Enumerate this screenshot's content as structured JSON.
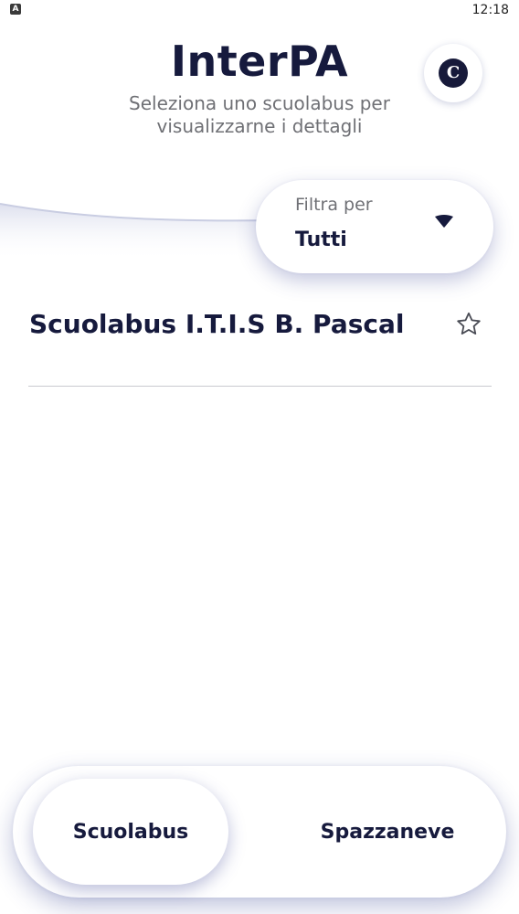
{
  "status_bar": {
    "app_icon_letter": "A",
    "time": "12:18"
  },
  "header": {
    "title": "InterPA",
    "subtitle": "Seleziona uno scuolabus per visualizzarne i dettagli",
    "profile_initial": "C"
  },
  "filter": {
    "label": "Filtra per",
    "selected": "Tutti",
    "icon": "caret-down-icon"
  },
  "list": {
    "items": [
      {
        "title": "Scuolabus I.T.I.S B. Pascal",
        "favorite": false,
        "icon": "star-outline-icon"
      }
    ]
  },
  "bottom_nav": {
    "tabs": [
      {
        "label": "Scuolabus",
        "active": true
      },
      {
        "label": "Spazzaneve",
        "active": false
      }
    ]
  },
  "colors": {
    "primary_dark": "#161a3d",
    "secondary_text": "#6f7075",
    "divider": "#c9cacf",
    "shadow_tint": "#3c4696"
  }
}
